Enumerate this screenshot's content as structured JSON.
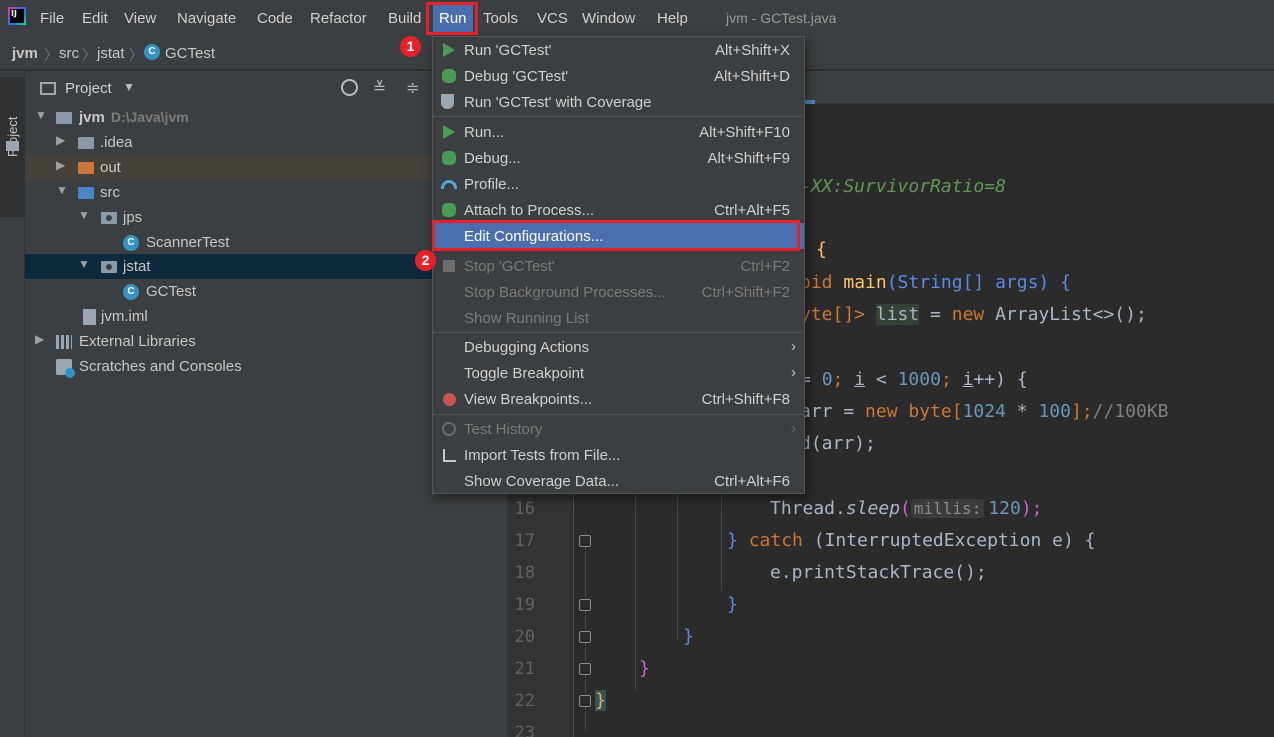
{
  "menubar": {
    "items": [
      "File",
      "Edit",
      "View",
      "Navigate",
      "Code",
      "Refactor",
      "Build",
      "Run",
      "Tools",
      "VCS",
      "Window",
      "Help"
    ],
    "window_title": "jvm - GCTest.java",
    "active_item": "Run"
  },
  "breadcrumb": [
    "jvm",
    "src",
    "jstat",
    "GCTest"
  ],
  "tool_stripe": {
    "project_label": "Project"
  },
  "project_panel": {
    "title": "Project",
    "tree": [
      {
        "label": "jvm",
        "sub": "D:\\Java\\jvm"
      },
      {
        "label": ".idea"
      },
      {
        "label": "out"
      },
      {
        "label": "src"
      },
      {
        "label": "jps"
      },
      {
        "label": "ScannerTest"
      },
      {
        "label": "jstat"
      },
      {
        "label": "GCTest"
      },
      {
        "label": "jvm.iml"
      },
      {
        "label": "External Libraries"
      },
      {
        "label": "Scratches and Consoles"
      }
    ]
  },
  "run_menu": {
    "items": [
      {
        "label": "Run 'GCTest'",
        "shortcut": "Alt+Shift+X",
        "icon": "run-icon"
      },
      {
        "label": "Debug 'GCTest'",
        "shortcut": "Alt+Shift+D",
        "icon": "debug-icon"
      },
      {
        "label": "Run 'GCTest' with Coverage",
        "shortcut": "",
        "icon": "coverage-icon"
      },
      {
        "label": "Run...",
        "shortcut": "Alt+Shift+F10",
        "icon": "run-icon"
      },
      {
        "label": "Debug...",
        "shortcut": "Alt+Shift+F9",
        "icon": "debug-icon"
      },
      {
        "label": "Profile...",
        "shortcut": "",
        "icon": "profile-icon"
      },
      {
        "label": "Attach to Process...",
        "shortcut": "Ctrl+Alt+F5",
        "icon": "attach-icon"
      },
      {
        "label": "Edit Configurations...",
        "shortcut": "",
        "icon": ""
      },
      {
        "label": "Stop 'GCTest'",
        "shortcut": "Ctrl+F2",
        "icon": "stop-icon"
      },
      {
        "label": "Stop Background Processes...",
        "shortcut": "Ctrl+Shift+F2",
        "icon": ""
      },
      {
        "label": "Show Running List",
        "shortcut": "",
        "icon": ""
      },
      {
        "label": "Debugging Actions",
        "shortcut": "",
        "icon": ""
      },
      {
        "label": "Toggle Breakpoint",
        "shortcut": "",
        "icon": ""
      },
      {
        "label": "View Breakpoints...",
        "shortcut": "Ctrl+Shift+F8",
        "icon": "breakpoint-icon"
      },
      {
        "label": "Test History",
        "shortcut": "",
        "icon": "history-icon"
      },
      {
        "label": "Import Tests from File...",
        "shortcut": "",
        "icon": "import-icon"
      },
      {
        "label": "Show Coverage Data...",
        "shortcut": "Ctrl+Alt+F6",
        "icon": ""
      }
    ]
  },
  "annotations": {
    "badge_1": "1",
    "badge_2": "2"
  },
  "editor": {
    "line_numbers": [
      "16",
      "17",
      "18",
      "19",
      "20",
      "21",
      "22",
      "23"
    ],
    "code": {
      "vm_option": "-XX:SurvivorRatio=8",
      "brace_open": "{",
      "main_sig_1": "oid ",
      "main_sig_2": "main",
      "main_sig_3": "(String[] args) {",
      "list_1": "yte[]> ",
      "list_2": "list",
      "list_3": " = ",
      "list_4": "new",
      "list_5": " ArrayList<>();",
      "for_1": "= ",
      "for_2": "0",
      "for_3": "; ",
      "for_4": "i",
      "for_5": " < ",
      "for_6": "1000",
      "for_7": "; ",
      "for_8": "i",
      "for_9": "++) {",
      "arr_1": "arr = ",
      "arr_2": "new",
      "arr_3": " byte[",
      "arr_4": "1024",
      "arr_5": " * ",
      "arr_6": "100",
      "arr_7": "];",
      "arr_8": "//100KB",
      "add_1": "d(arr);",
      "sleep_1": "Thread.",
      "sleep_2": "sleep",
      "sleep_3": "(",
      "sleep_hint": "millis:",
      "sleep_4": "120",
      "sleep_5": ");",
      "catch_1": "} ",
      "catch_2": "catch",
      "catch_3": " (InterruptedException e) {",
      "print_1": "e.printStackTrace();",
      "close_19": "}",
      "close_20": "}",
      "close_21": "}",
      "close_22": "}"
    }
  },
  "colors": {
    "accent": "#4b6eaf",
    "annotation": "#e8202a"
  }
}
